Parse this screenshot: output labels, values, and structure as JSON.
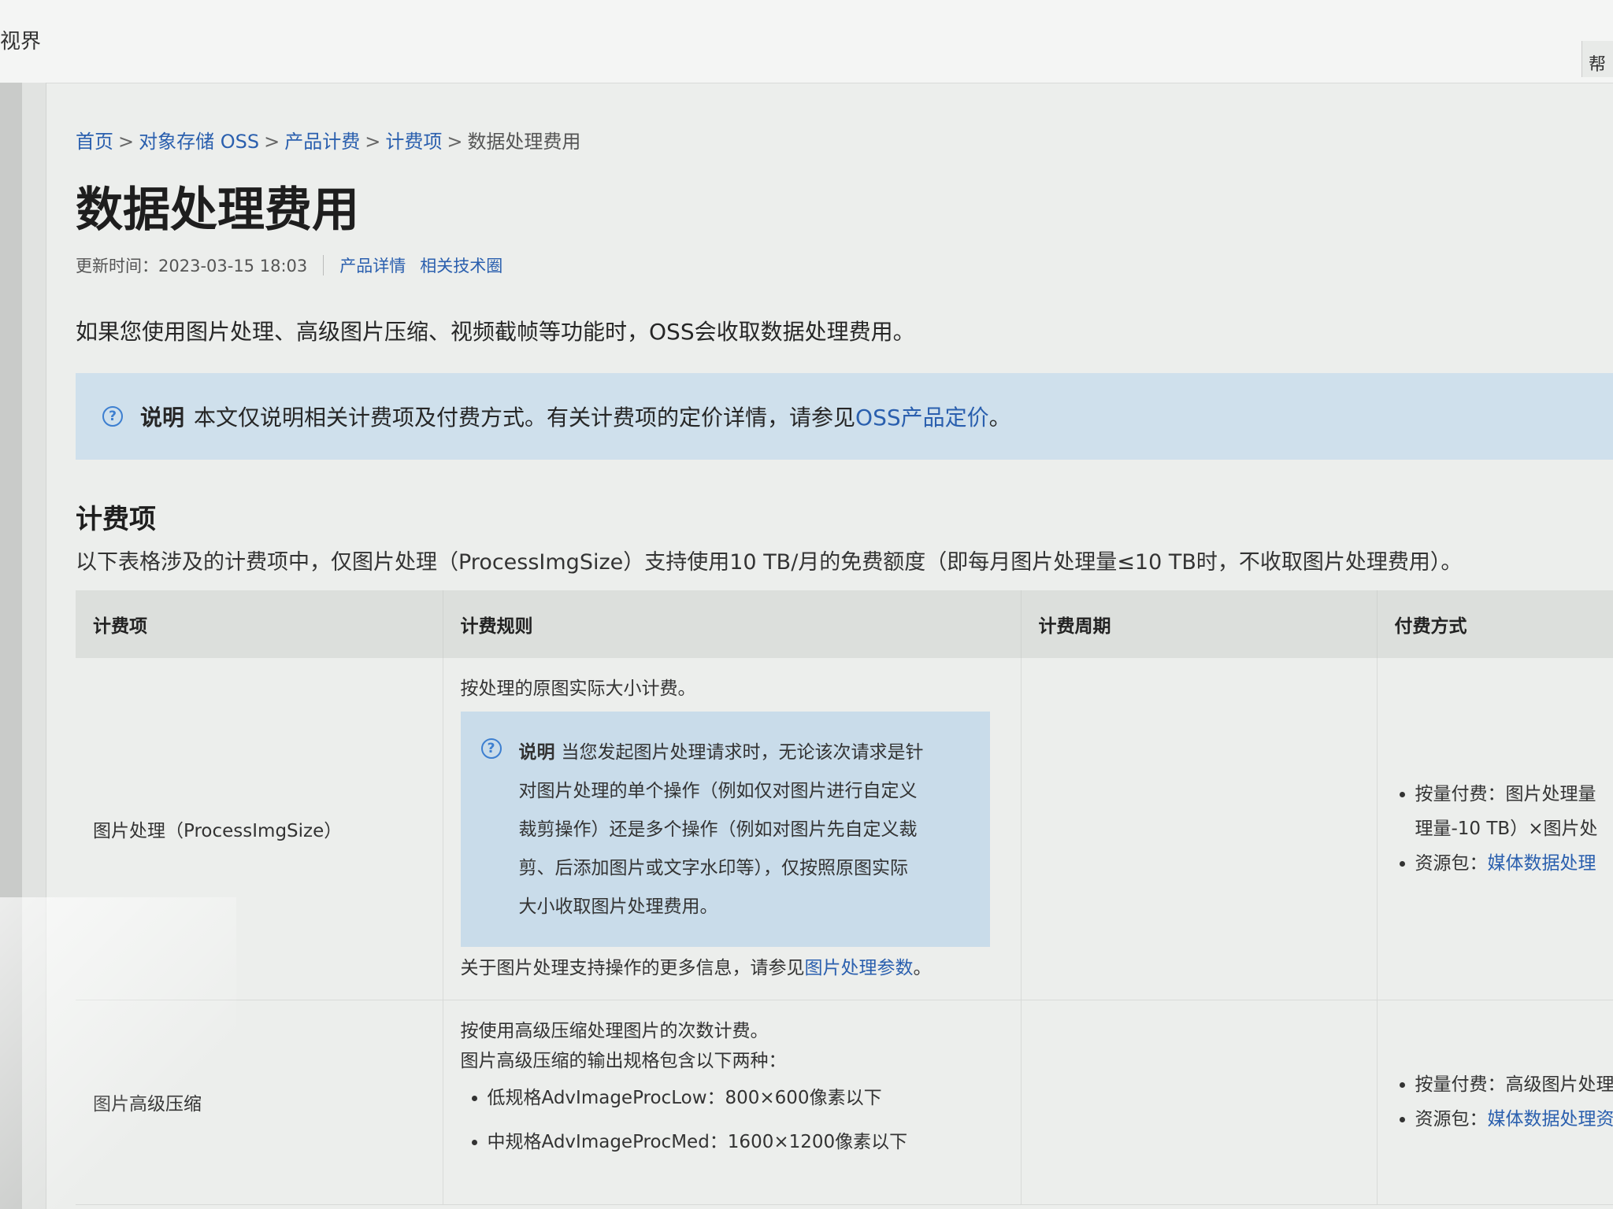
{
  "topbar": {
    "brand": "视界",
    "edge_text": "帮"
  },
  "breadcrumb": {
    "items": [
      "首页",
      "对象存储 OSS",
      "产品计费",
      "计费项"
    ],
    "current": "数据处理费用",
    "separator": ">"
  },
  "page": {
    "title": "数据处理费用",
    "updated": "更新时间：2023-03-15 18:03",
    "links": [
      "产品详情",
      "相关技术圈"
    ],
    "intro": "如果您使用图片处理、高级图片压缩、视频截帧等功能时，OSS会收取数据处理费用。"
  },
  "note": {
    "label": "说明",
    "text": "本文仅说明相关计费项及付费方式。有关计费项的定价详情，请参见",
    "link": "OSS产品定价",
    "end": "。"
  },
  "section": {
    "title": "计费项",
    "desc": "以下表格涉及的计费项中，仅图片处理（ProcessImgSize）支持使用10 TB/月的免费额度（即每月图片处理量≤10 TB时，不收取图片处理费用）。"
  },
  "table": {
    "headers": [
      "计费项",
      "计费规则",
      "计费周期",
      "付费方式"
    ],
    "rows": [
      {
        "item": "图片处理（ProcessImgSize）",
        "rule_intro": "按处理的原图实际大小计费。",
        "note_label": "说明",
        "note_lines": [
          "当您发起图片处理请求时，无论该次请求是针",
          "对图片处理的单个操作（例如仅对图片进行自定义",
          "裁剪操作）还是多个操作（例如对图片先自定义裁",
          "剪、后添加图片或文字水印等），仅按照原图实际",
          "大小收取图片处理费用。"
        ],
        "rule_more": "关于图片处理支持操作的更多信息，请参见",
        "rule_more_link": "图片处理参数",
        "rule_more_end": "。",
        "pay": [
          {
            "label": "按量付费：",
            "text": "图片处理量",
            "line2": "理量-10 TB）×图片处"
          },
          {
            "label": "资源包：",
            "link": "媒体数据处理"
          }
        ]
      },
      {
        "item": "图片高级压缩",
        "rule_lines": [
          "按使用高级压缩处理图片的次数计费。",
          "图片高级压缩的输出规格包含以下两种："
        ],
        "bullets": [
          "低规格AdvImageProcLow：800×600像素以下",
          "中规格AdvImageProcMed：1600×1200像素以下"
        ],
        "pay": [
          {
            "label": "按量付费：",
            "text": "高级图片处理"
          },
          {
            "label": "资源包：",
            "link": "媒体数据处理资"
          }
        ]
      }
    ]
  }
}
